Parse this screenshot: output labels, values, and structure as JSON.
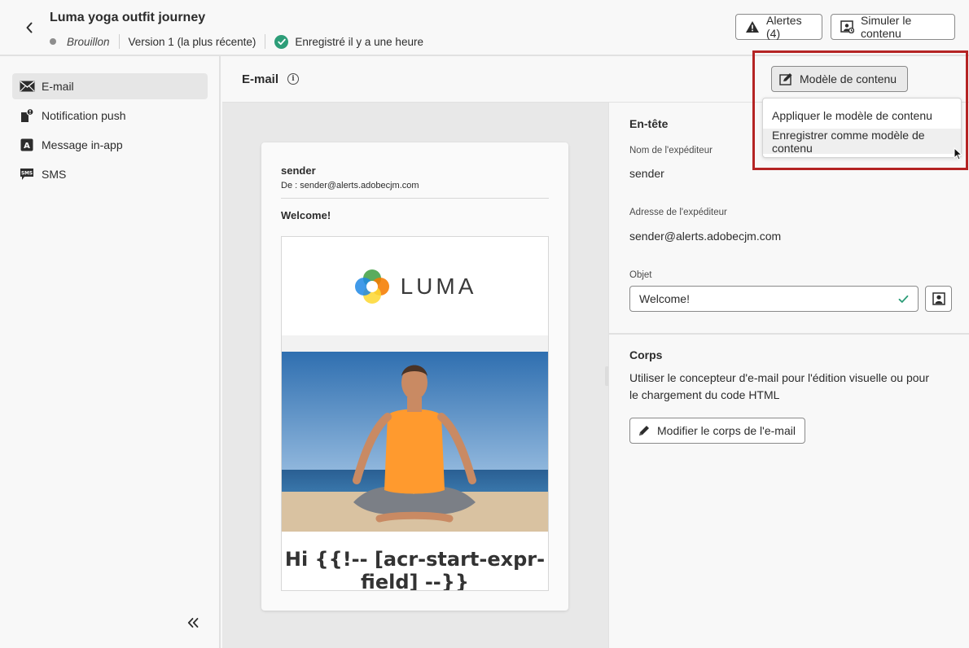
{
  "header": {
    "title": "Luma yoga outfit journey",
    "status": "Brouillon",
    "version": "Version 1 (la plus récente)",
    "saved": "Enregistré il y a une heure",
    "alerts_label": "Alertes (4)",
    "simulate_label": "Simuler le contenu"
  },
  "sidebar": {
    "items": [
      {
        "label": "E-mail",
        "icon": "mail-icon",
        "active": true
      },
      {
        "label": "Notification push",
        "icon": "push-notification-icon"
      },
      {
        "label": "Message in-app",
        "icon": "in-app-icon"
      },
      {
        "label": "SMS",
        "icon": "sms-icon"
      }
    ]
  },
  "section": {
    "title": "E-mail"
  },
  "preview": {
    "sender": "sender",
    "from_label": "De :",
    "from_address": "sender@alerts.adobecjm.com",
    "subject": "Welcome!",
    "logo_text": "LUMA",
    "greeting": "Hi {{!-- [acr-start-expr-field] --}}"
  },
  "header_panel": {
    "title": "En-tête",
    "sender_name_label": "Nom de l'expéditeur",
    "sender_name_value": "sender",
    "sender_address_label": "Adresse de l'expéditeur",
    "sender_address_value": "sender@alerts.adobecjm.com",
    "subject_label": "Objet",
    "subject_value": "Welcome!"
  },
  "body_panel": {
    "title": "Corps",
    "description": "Utiliser le concepteur d'e-mail pour l'édition visuelle ou pour le chargement du code HTML",
    "edit_button": "Modifier le corps de l'e-mail"
  },
  "template_menu": {
    "button_label": "Modèle de contenu",
    "items": [
      {
        "label": "Appliquer le modèle de contenu"
      },
      {
        "label": "Enregistrer comme modèle de contenu",
        "hovered": true
      }
    ]
  },
  "colors": {
    "success": "#2d9d78",
    "highlight": "#b52424"
  }
}
